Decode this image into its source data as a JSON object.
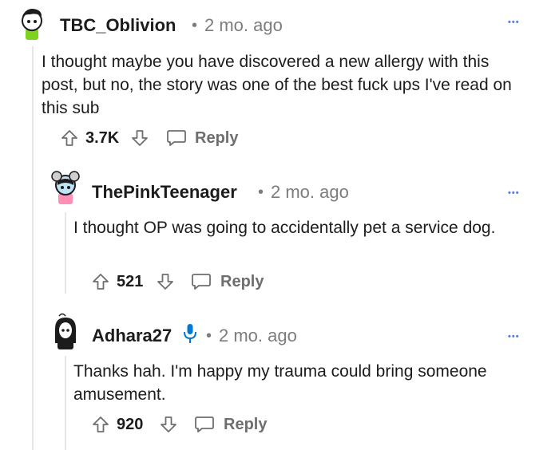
{
  "comments": [
    {
      "author": "TBC_Oblivion",
      "separator": "•",
      "time": "2 mo. ago",
      "more": "•••",
      "body": "I thought maybe you have discovered a new allergy with this post, but no, the story was one of the best fuck ups I've read on this sub",
      "votes": "3.7K",
      "reply_label": "Reply"
    },
    {
      "author": "ThePinkTeenager",
      "separator": "•",
      "time": "2 mo. ago",
      "more": "•••",
      "body": "I thought OP was going to accidentally pet a service dog.",
      "votes": "521",
      "reply_label": "Reply"
    },
    {
      "author": "Adhara27",
      "separator": "•",
      "time": "2 mo. ago",
      "more": "•••",
      "body": "Thanks hah. I'm happy my trauma could bring someone amusement.",
      "votes": "920",
      "reply_label": "Reply",
      "badge_icon": "microphone-icon"
    }
  ],
  "colors": {
    "accent": "#0079d3",
    "muted": "#7c7c7c",
    "line": "#e6e6e6"
  }
}
